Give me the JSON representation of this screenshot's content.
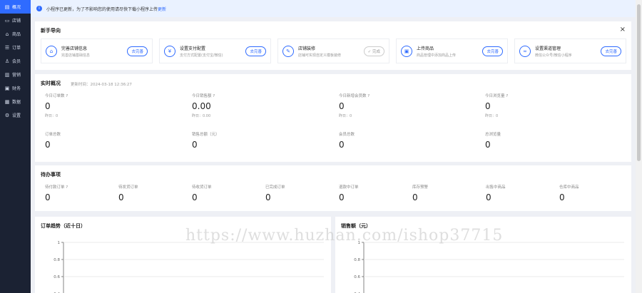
{
  "sidebar": {
    "items": [
      {
        "label": "概况",
        "icon": "overview-icon",
        "active": true
      },
      {
        "label": "店铺",
        "icon": "store-icon"
      },
      {
        "label": "商品",
        "icon": "goods-icon"
      },
      {
        "label": "订单",
        "icon": "order-icon"
      },
      {
        "label": "会员",
        "icon": "member-icon"
      },
      {
        "label": "营销",
        "icon": "marketing-icon"
      },
      {
        "label": "财务",
        "icon": "finance-icon"
      },
      {
        "label": "数据",
        "icon": "data-icon"
      },
      {
        "label": "设置",
        "icon": "settings-icon"
      }
    ]
  },
  "notice": {
    "text": "小程序已更新，为了不影响您的使用请尽快下载小程序上传",
    "link": "更新"
  },
  "guide": {
    "title": "新手导向",
    "items": [
      {
        "name": "完善店铺信息",
        "desc": "完善店铺基础信息",
        "button": "去完善",
        "done": false
      },
      {
        "name": "设置支付配置",
        "desc": "支付方式配置(支付宝/微信)",
        "button": "去完善",
        "done": false
      },
      {
        "name": "店铺装修",
        "desc": "店铺可实现自定义模板装修",
        "button": "✓ 完成",
        "done": true
      },
      {
        "name": "上传商品",
        "desc": "商品管理中添加商品上传",
        "button": "去完善",
        "done": false
      },
      {
        "name": "设置渠道管理",
        "desc": "微信公众号/微信小程序",
        "button": "去完善",
        "done": false
      }
    ]
  },
  "realtime": {
    "title": "实时概况",
    "time": "更新时间：2024-03-18 12:36:27",
    "stats": [
      {
        "label": "今日订单数",
        "value": "0",
        "sub": "昨日：0"
      },
      {
        "label": "今日销售额",
        "value": "0.00",
        "sub": "昨日：0.00"
      },
      {
        "label": "今日新增会员数",
        "value": "0",
        "sub": "昨日：0"
      },
      {
        "label": "今日浏览量",
        "value": "0",
        "sub": "昨日：0"
      },
      {
        "label": "订单总数",
        "value": "0"
      },
      {
        "label": "销售总额（元）",
        "value": "0"
      },
      {
        "label": "会员总数",
        "value": "0"
      },
      {
        "label": "总浏览量",
        "value": "0"
      }
    ]
  },
  "todo": {
    "title": "待办事项",
    "items": [
      {
        "label": "待付款订单",
        "value": "0"
      },
      {
        "label": "待发货订单",
        "value": "0"
      },
      {
        "label": "待收货订单",
        "value": "0"
      },
      {
        "label": "已完成订单",
        "value": "0"
      },
      {
        "label": "退款中订单",
        "value": "0"
      },
      {
        "label": "库存预警",
        "value": "0"
      },
      {
        "label": "出售中商品",
        "value": "0"
      },
      {
        "label": "仓库中商品",
        "value": "0"
      }
    ]
  },
  "watermark": "https://www.huzhan.com/ishop37715",
  "chart_data": [
    {
      "type": "line",
      "title": "订单趋势（近十日）",
      "ylim": [
        0,
        1
      ],
      "yticks": [
        "1",
        "0.8",
        "0.6",
        "0.4"
      ],
      "series": []
    },
    {
      "type": "line",
      "title": "销售额（元）",
      "ylim": [
        0,
        1
      ],
      "yticks": [
        "1",
        "0.8",
        "0.6",
        "0.4"
      ],
      "series": []
    }
  ],
  "colors": {
    "primary": "#2f6bff",
    "sidebar": "#1b2233"
  }
}
